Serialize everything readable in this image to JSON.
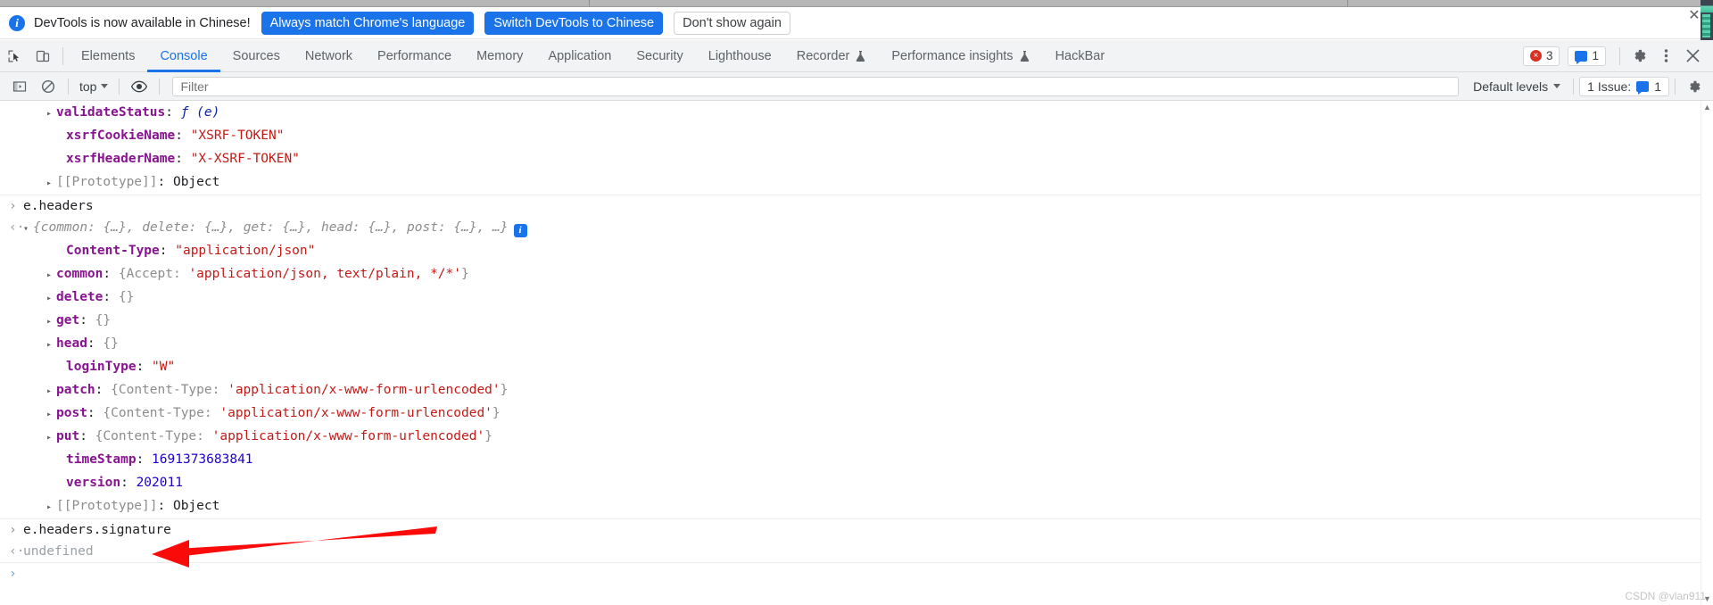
{
  "banner": {
    "info_icon": "info-icon",
    "message": "DevTools is now available in Chinese!",
    "buttons": [
      {
        "label": "Always match Chrome's language",
        "style": "primary"
      },
      {
        "label": "Switch DevTools to Chinese",
        "style": "primary"
      },
      {
        "label": "Don't show again",
        "style": "secondary"
      }
    ],
    "close_label": "✕"
  },
  "tabbar": {
    "inspect_icon": "inspect-element-icon",
    "device_icon": "device-toolbar-icon",
    "tabs": [
      {
        "label": "Elements",
        "active": false,
        "experimental": false
      },
      {
        "label": "Console",
        "active": true,
        "experimental": false
      },
      {
        "label": "Sources",
        "active": false,
        "experimental": false
      },
      {
        "label": "Network",
        "active": false,
        "experimental": false
      },
      {
        "label": "Performance",
        "active": false,
        "experimental": false
      },
      {
        "label": "Memory",
        "active": false,
        "experimental": false
      },
      {
        "label": "Application",
        "active": false,
        "experimental": false
      },
      {
        "label": "Security",
        "active": false,
        "experimental": false
      },
      {
        "label": "Lighthouse",
        "active": false,
        "experimental": false
      },
      {
        "label": "Recorder",
        "active": false,
        "experimental": true
      },
      {
        "label": "Performance insights",
        "active": false,
        "experimental": true
      },
      {
        "label": "HackBar",
        "active": false,
        "experimental": false
      }
    ],
    "error_badge": {
      "icon": "error-icon",
      "count": "3"
    },
    "message_badge": {
      "icon": "message-icon",
      "count": "1"
    },
    "settings_icon": "gear-icon",
    "more_icon": "more-options-icon",
    "close_icon": "close-icon"
  },
  "filterbar": {
    "sidebar_icon": "console-sidebar-icon",
    "clear_icon": "clear-console-icon",
    "context": "top",
    "eye_icon": "live-expression-icon",
    "filter_placeholder": "Filter",
    "filter_value": "",
    "levels_label": "Default levels",
    "issues_label": "1 Issue:",
    "issues_count": "1",
    "settings_icon": "console-settings-icon"
  },
  "console": {
    "rows": [
      {
        "kind": "prop",
        "indent": "indent1",
        "triangle": "closed",
        "key": "validateStatus",
        "sep": ": ",
        "value": "ƒ (e)",
        "value_class": "fn"
      },
      {
        "kind": "prop",
        "indent": "indent2",
        "triangle": "none",
        "key": "xsrfCookieName",
        "sep": ": ",
        "value": "\"XSRF-TOKEN\"",
        "value_class": "str"
      },
      {
        "kind": "prop",
        "indent": "indent2",
        "triangle": "none",
        "key": "xsrfHeaderName",
        "sep": ": ",
        "value": "\"X-XSRF-TOKEN\"",
        "value_class": "str"
      },
      {
        "kind": "prop",
        "indent": "indent1",
        "triangle": "closed",
        "key": "[[Prototype]]",
        "key_class": "kg",
        "sep": ": ",
        "value": "Object",
        "value_class": "plain"
      },
      {
        "kind": "input",
        "gutter": "›",
        "text": "e.headers"
      },
      {
        "kind": "output-object",
        "gutter": "‹·",
        "triangle": "open",
        "preview": "{common: {…}, delete: {…}, get: {…}, head: {…}, post: {…}, …}",
        "info_badge": "info-icon"
      },
      {
        "kind": "prop",
        "indent": "indent2",
        "triangle": "none",
        "key": "Content-Type",
        "sep": ": ",
        "value": "\"application/json\"",
        "value_class": "str"
      },
      {
        "kind": "prop-obj",
        "indent": "indent1",
        "triangle": "closed",
        "key": "common",
        "sep": ": ",
        "brace_open": "{",
        "inner_key": "Accept",
        "inner_sep": ": ",
        "inner_value": "'application/json, text/plain, */*'",
        "brace_close": "}"
      },
      {
        "kind": "prop",
        "indent": "indent1",
        "triangle": "closed",
        "key": "delete",
        "sep": ": ",
        "value": "{}",
        "value_class": "brace"
      },
      {
        "kind": "prop",
        "indent": "indent1",
        "triangle": "closed",
        "key": "get",
        "sep": ": ",
        "value": "{}",
        "value_class": "brace"
      },
      {
        "kind": "prop",
        "indent": "indent1",
        "triangle": "closed",
        "key": "head",
        "sep": ": ",
        "value": "{}",
        "value_class": "brace"
      },
      {
        "kind": "prop",
        "indent": "indent2",
        "triangle": "none",
        "key": "loginType",
        "sep": ": ",
        "value": "\"W\"",
        "value_class": "str"
      },
      {
        "kind": "prop-obj",
        "indent": "indent1",
        "triangle": "closed",
        "key": "patch",
        "sep": ": ",
        "brace_open": "{",
        "inner_key": "Content-Type",
        "inner_sep": ": ",
        "inner_value": "'application/x-www-form-urlencoded'",
        "brace_close": "}"
      },
      {
        "kind": "prop-obj",
        "indent": "indent1",
        "triangle": "closed",
        "key": "post",
        "sep": ": ",
        "brace_open": "{",
        "inner_key": "Content-Type",
        "inner_sep": ": ",
        "inner_value": "'application/x-www-form-urlencoded'",
        "brace_close": "}"
      },
      {
        "kind": "prop-obj",
        "indent": "indent1",
        "triangle": "closed",
        "key": "put",
        "sep": ": ",
        "brace_open": "{",
        "inner_key": "Content-Type",
        "inner_sep": ": ",
        "inner_value": "'application/x-www-form-urlencoded'",
        "brace_close": "}"
      },
      {
        "kind": "prop",
        "indent": "indent2",
        "triangle": "none",
        "key": "timeStamp",
        "sep": ": ",
        "value": "1691373683841",
        "value_class": "num"
      },
      {
        "kind": "prop",
        "indent": "indent2",
        "triangle": "none",
        "key": "version",
        "sep": ": ",
        "value": "202011",
        "value_class": "num"
      },
      {
        "kind": "prop",
        "indent": "indent1",
        "triangle": "closed",
        "key": "[[Prototype]]",
        "key_class": "kg",
        "sep": ": ",
        "value": "Object",
        "value_class": "plain"
      },
      {
        "kind": "input",
        "gutter": "›",
        "text": "e.headers.signature"
      },
      {
        "kind": "output-undef",
        "gutter": "‹·",
        "text": "undefined"
      },
      {
        "kind": "prompt",
        "gutter": "›",
        "text": ""
      }
    ]
  },
  "annotation": {
    "arrow_color": "#fb0a0a",
    "name": "red-arrow-annotation"
  },
  "watermark": "CSDN @vlan911",
  "colors": {
    "accent_blue": "#1a73e8",
    "error_red": "#d93025",
    "key_purple": "#881391",
    "string_red": "#c41a16",
    "number_blue": "#1c00cf",
    "toolbar_bg": "#f1f3f4"
  }
}
